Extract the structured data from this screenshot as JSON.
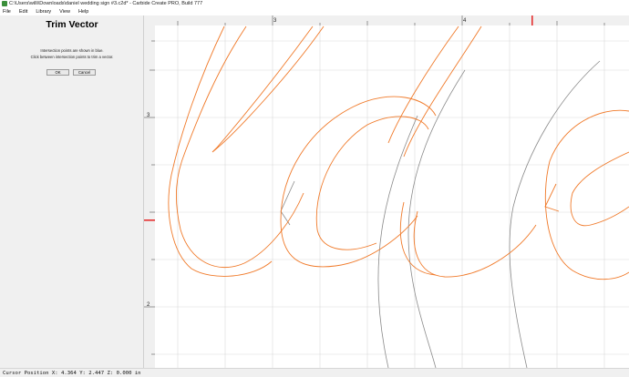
{
  "window": {
    "title": "C:\\Users\\willi\\Downloads\\daniel wedding sign #3.c2d* - Carbide Create PRO, Build 777"
  },
  "menu": {
    "items": [
      "File",
      "Edit",
      "Library",
      "View",
      "Help"
    ]
  },
  "panel": {
    "title": "Trim Vector",
    "instructions": [
      "Intersection points are shown in blue.",
      "Click between intersection points to trim a vector."
    ],
    "ok_label": "OK",
    "cancel_label": "Cancel"
  },
  "rulers": {
    "top_labels": [
      "3",
      "4"
    ],
    "left_labels": [
      "3",
      "2"
    ]
  },
  "status": {
    "cursor_position": "Cursor Position X: 4.364 Y: 2.447 Z: 0.000 in"
  },
  "colors": {
    "vector_selected": "#f07a2a",
    "vector_gray": "#8a8a8a",
    "ruler_marker": "#e53030",
    "grid": "#d9d9d9",
    "app_icon": "#3a8f3a"
  },
  "icons": {
    "app": "carbide-create-icon"
  }
}
